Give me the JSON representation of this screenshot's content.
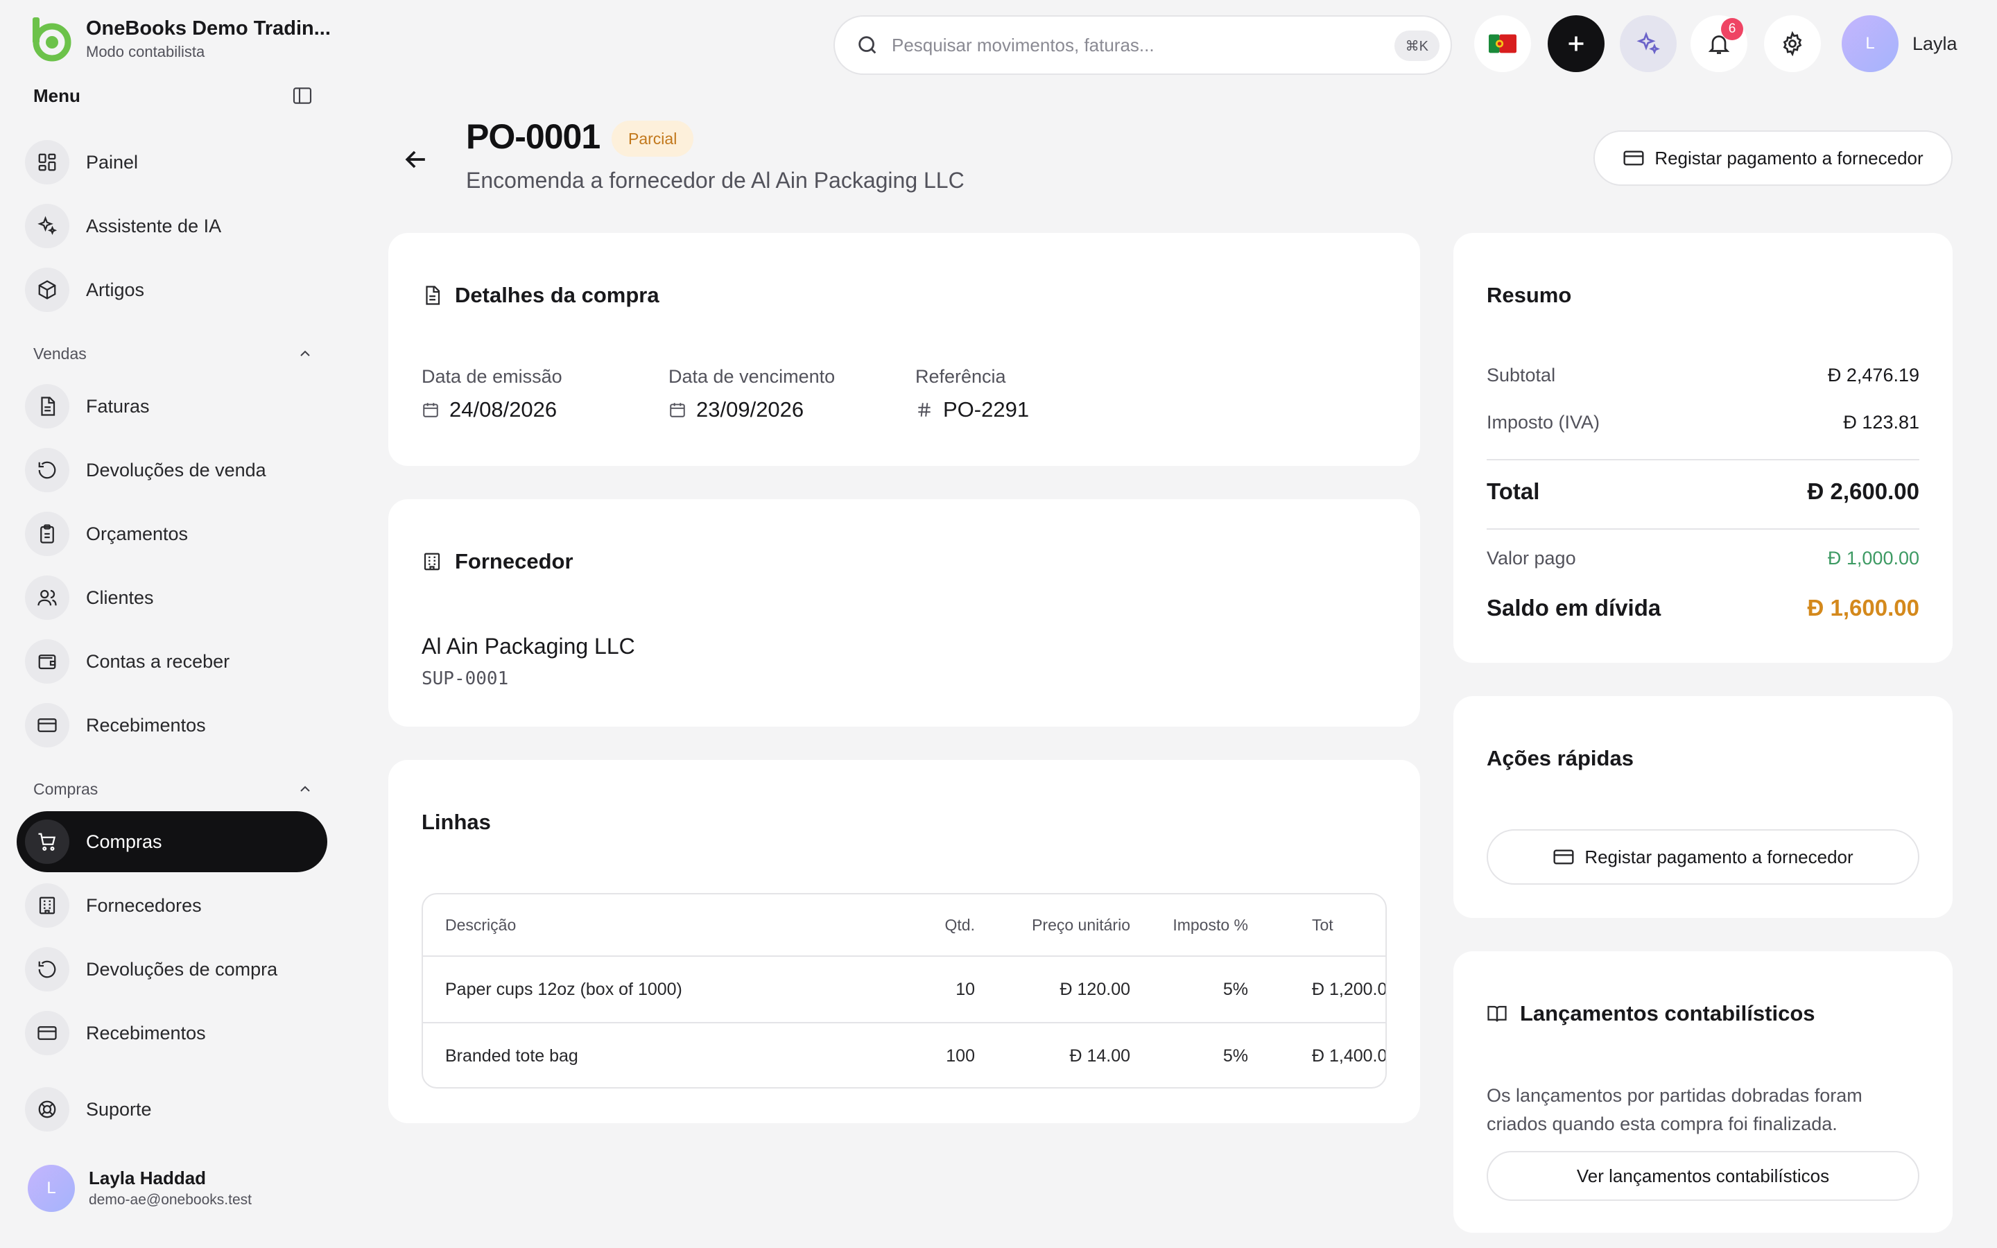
{
  "brand": {
    "name": "OneBooks Demo Tradin...",
    "subtitle": "Modo contabilista"
  },
  "sidebar": {
    "menu_title": "Menu",
    "top_items": [
      {
        "label": "Painel",
        "icon": "dashboard-icon"
      },
      {
        "label": "Assistente de IA",
        "icon": "sparkles-icon"
      },
      {
        "label": "Artigos",
        "icon": "box-icon"
      }
    ],
    "sections": [
      {
        "title": "Vendas",
        "items": [
          {
            "label": "Faturas",
            "icon": "file-text-icon"
          },
          {
            "label": "Devoluções de venda",
            "icon": "rotate-ccw-icon"
          },
          {
            "label": "Orçamentos",
            "icon": "clipboard-icon"
          },
          {
            "label": "Clientes",
            "icon": "users-icon"
          },
          {
            "label": "Contas a receber",
            "icon": "wallet-icon"
          },
          {
            "label": "Recebimentos",
            "icon": "credit-card-icon"
          }
        ]
      },
      {
        "title": "Compras",
        "items": [
          {
            "label": "Compras",
            "icon": "cart-icon",
            "active": true
          },
          {
            "label": "Fornecedores",
            "icon": "building-icon"
          },
          {
            "label": "Devoluções de compra",
            "icon": "rotate-ccw-icon"
          },
          {
            "label": "Recebimentos",
            "icon": "credit-card-icon"
          }
        ]
      }
    ],
    "support_label": "Suporte",
    "user": {
      "initial": "L",
      "name": "Layla Haddad",
      "email": "demo-ae@onebooks.test"
    }
  },
  "topbar": {
    "search_placeholder": "Pesquisar movimentos, faturas...",
    "shortcut": "⌘K",
    "notifications_count": "6",
    "user_initial": "L",
    "user_name": "Layla"
  },
  "header": {
    "title": "PO-0001",
    "status": "Parcial",
    "subtitle": "Encomenda a fornecedor de Al Ain Packaging LLC",
    "action_label": "Registar pagamento a fornecedor"
  },
  "details": {
    "title": "Detalhes da compra",
    "issue_label": "Data de emissão",
    "issue_date": "24/08/2026",
    "due_label": "Data de vencimento",
    "due_date": "23/09/2026",
    "ref_label": "Referência",
    "ref_value": "PO-2291"
  },
  "supplier": {
    "title": "Fornecedor",
    "name": "Al Ain Packaging LLC",
    "code": "SUP-0001"
  },
  "lines": {
    "title": "Linhas",
    "headers": {
      "description": "Descrição",
      "qty": "Qtd.",
      "price": "Preço unitário",
      "tax": "Imposto %",
      "total": "Tot"
    },
    "rows": [
      {
        "description": "Paper cups 12oz (box of 1000)",
        "qty": "10",
        "price": "120.00",
        "tax": "5%",
        "total": "1,200.0"
      },
      {
        "description": "Branded tote bag",
        "qty": "100",
        "price": "14.00",
        "tax": "5%",
        "total": "1,400.0"
      }
    ]
  },
  "summary": {
    "title": "Resumo",
    "subtotal_label": "Subtotal",
    "subtotal": "2,476.19",
    "tax_label": "Imposto (IVA)",
    "tax": "123.81",
    "total_label": "Total",
    "total": "2,600.00",
    "paid_label": "Valor pago",
    "paid": "1,000.00",
    "due_label": "Saldo em dívida",
    "due": "1,600.00"
  },
  "quick_actions": {
    "title": "Ações rápidas",
    "pay_label": "Registar pagamento a fornecedor"
  },
  "ledger": {
    "title": "Lançamentos contabilísticos",
    "text": "Os lançamentos por partidas dobradas foram criados quando esta compra foi finalizada.",
    "button_label": "Ver lançamentos contabilísticos"
  },
  "colors": {
    "accent_green": "#6cc24a",
    "active_nav": "#111113",
    "badge_partial_bg": "#fdf0db",
    "badge_partial_fg": "#c2781c",
    "paid_green": "#3d9a63",
    "due_orange": "#d4891c",
    "notification_red": "#ef4464"
  }
}
